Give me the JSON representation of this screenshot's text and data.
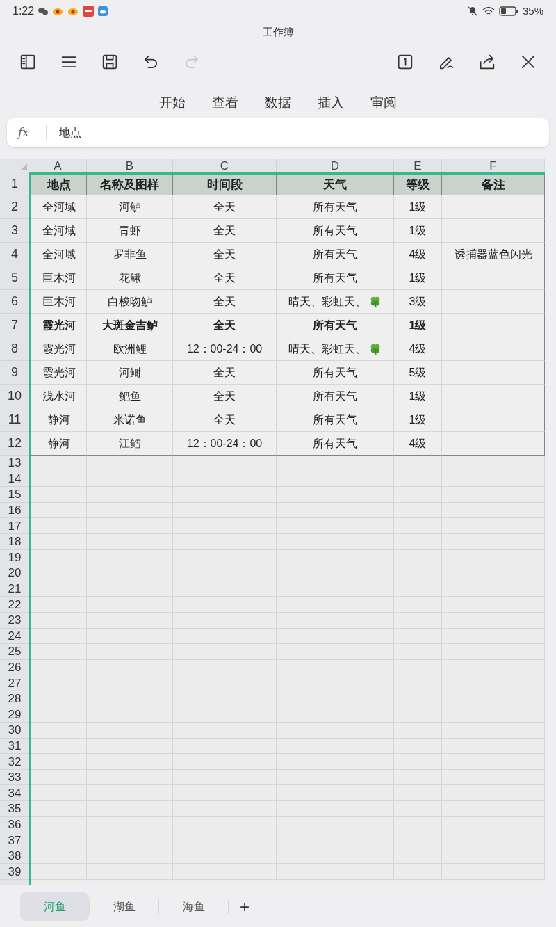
{
  "status_bar": {
    "time": "1:22",
    "battery_text": "35%"
  },
  "window": {
    "title": "工作簿"
  },
  "menu_tabs": [
    {
      "label": "开始",
      "selected": false
    },
    {
      "label": "查看",
      "selected": false
    },
    {
      "label": "数据",
      "selected": false
    },
    {
      "label": "插入",
      "selected": false
    },
    {
      "label": "审阅",
      "selected": false
    }
  ],
  "formula_bar": {
    "label": "fx",
    "value": "地点"
  },
  "sheet": {
    "columns": [
      "A",
      "B",
      "C",
      "D",
      "E",
      "F"
    ],
    "header": {
      "number": "1",
      "cells": [
        "地点",
        "名称及图样",
        "时间段",
        "天气",
        "等级",
        "备注"
      ]
    },
    "rows": [
      {
        "number": "2",
        "bold": false,
        "cells": [
          "全河域",
          "河鲈",
          "全天",
          "所有天气",
          "1级",
          ""
        ]
      },
      {
        "number": "3",
        "bold": false,
        "cells": [
          "全河域",
          "青虾",
          "全天",
          "所有天气",
          "1级",
          ""
        ]
      },
      {
        "number": "4",
        "bold": false,
        "cells": [
          "全河域",
          "罗非鱼",
          "全天",
          "所有天气",
          "4级",
          "诱捕器蓝色闪光"
        ]
      },
      {
        "number": "5",
        "bold": false,
        "cells": [
          "巨木河",
          "花鳅",
          "全天",
          "所有天气",
          "1级",
          ""
        ]
      },
      {
        "number": "6",
        "bold": false,
        "cells": [
          "巨木河",
          "白梭吻鲈",
          "全天",
          "晴天、彩虹天、",
          "3级",
          ""
        ],
        "clover": true
      },
      {
        "number": "7",
        "bold": true,
        "cells": [
          "霞光河",
          "大斑金吉鲈",
          "全天",
          "所有天气",
          "1级",
          ""
        ]
      },
      {
        "number": "8",
        "bold": false,
        "cells": [
          "霞光河",
          "欧洲鲤",
          "12：00-24：00",
          "晴天、彩虹天、",
          "4级",
          ""
        ],
        "clover": true
      },
      {
        "number": "9",
        "bold": false,
        "cells": [
          "霞光河",
          "河鲥",
          "全天",
          "所有天气",
          "5级",
          ""
        ]
      },
      {
        "number": "10",
        "bold": false,
        "cells": [
          "浅水河",
          "鲃鱼",
          "全天",
          "所有天气",
          "1级",
          ""
        ]
      },
      {
        "number": "11",
        "bold": false,
        "cells": [
          "静河",
          "米诺鱼",
          "全天",
          "所有天气",
          "1级",
          ""
        ]
      },
      {
        "number": "12",
        "bold": false,
        "cells": [
          "静河",
          "江鳕",
          "12：00-24：00",
          "所有天气",
          "4级",
          ""
        ]
      }
    ],
    "empty_rows": [
      "13",
      "14",
      "15",
      "16",
      "17",
      "18",
      "19",
      "20",
      "21",
      "22",
      "23",
      "24",
      "25",
      "26",
      "27",
      "28",
      "29",
      "30",
      "31",
      "32",
      "33",
      "34",
      "35",
      "36",
      "37",
      "38",
      "39"
    ]
  },
  "sheet_tabs": [
    {
      "label": "河鱼",
      "selected": true
    },
    {
      "label": "湖鱼",
      "selected": false
    },
    {
      "label": "海鱼",
      "selected": false
    }
  ],
  "add_sheet": "+"
}
